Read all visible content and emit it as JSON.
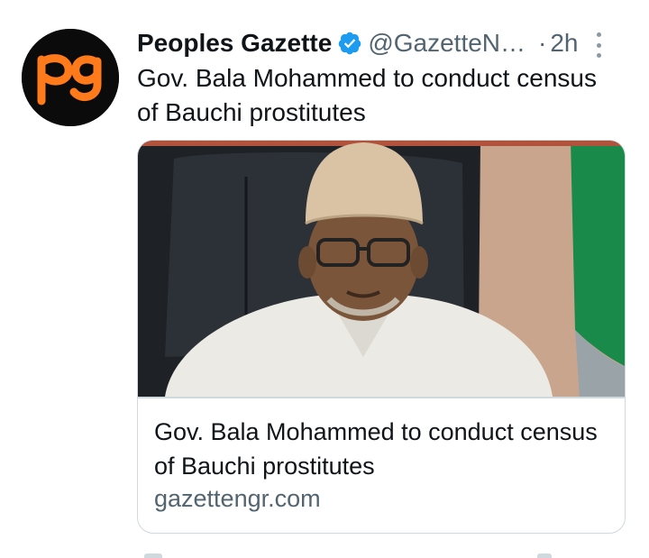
{
  "tweet": {
    "avatar": {
      "text": "pg",
      "bg_color": "#0b0b0b",
      "logo_color": "#ff7a1a"
    },
    "display_name": "Peoples Gazette",
    "handle": "@GazetteN…",
    "separator": "·",
    "time": "2h",
    "verified_icon": "verified-badge-icon",
    "more_icon": "more-vertical-icon",
    "text": "Gov. Bala Mohammed to conduct census of Bauchi prostitutes",
    "card": {
      "title": "Gov. Bala Mohammed to conduct census of Bauchi prostitutes",
      "domain": "gazettengr.com",
      "image_alt": "photo-of-man-in-white-cap-and-glasses"
    }
  },
  "colors": {
    "text_primary": "#0f1419",
    "text_secondary": "#536471",
    "verified_blue": "#1d9bf0",
    "border": "#cfd9de"
  }
}
